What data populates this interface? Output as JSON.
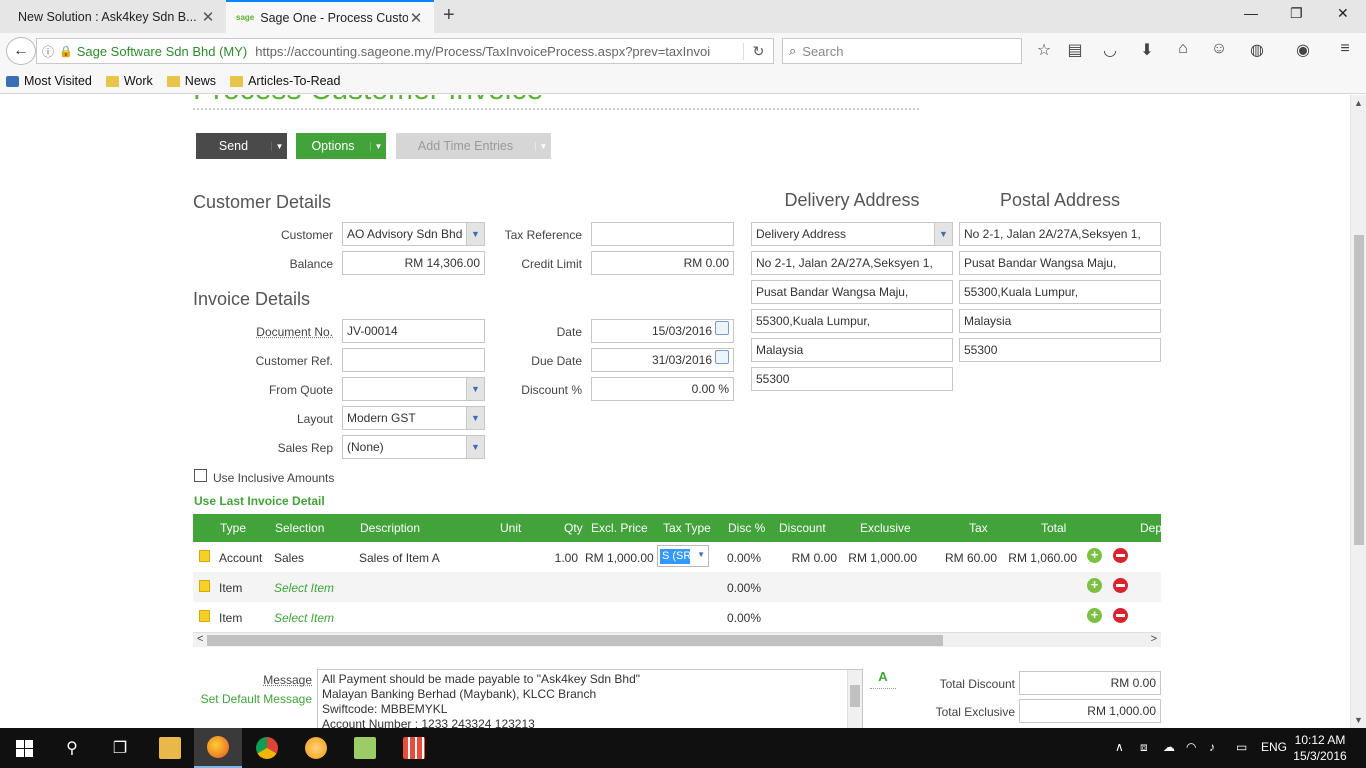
{
  "browser": {
    "tabs": [
      {
        "title": "New Solution : Ask4key Sdn B..."
      },
      {
        "title": "Sage One - Process Custo...",
        "favicon": "sage"
      }
    ],
    "url": {
      "site_identity": "Sage Software Sdn Bhd (MY)",
      "address": "https://accounting.sageone.my/Process/TaxInvoiceProcess.aspx?prev=taxInvoi"
    },
    "search_placeholder": "Search",
    "bookmarks": [
      "Most Visited",
      "Work",
      "News",
      "Articles-To-Read"
    ]
  },
  "page": {
    "title": "Process Customer Invoice",
    "toolbar": {
      "send": "Send",
      "options": "Options",
      "add_time_entries": "Add Time Entries"
    },
    "customer_details": {
      "heading": "Customer Details",
      "customer_label": "Customer",
      "customer_value": "AO Advisory Sdn Bhd",
      "balance_label": "Balance",
      "balance_value": "RM 14,306.00",
      "tax_ref_label": "Tax Reference",
      "tax_ref_value": "",
      "credit_limit_label": "Credit Limit",
      "credit_limit_value": "RM 0.00"
    },
    "invoice_details": {
      "heading": "Invoice Details",
      "doc_no_label": "Document No.",
      "doc_no_value": "JV-00014",
      "cust_ref_label": "Customer Ref.",
      "cust_ref_value": "",
      "from_quote_label": "From Quote",
      "from_quote_value": "",
      "layout_label": "Layout",
      "layout_value": "Modern GST",
      "sales_rep_label": "Sales Rep",
      "sales_rep_value": "(None)",
      "date_label": "Date",
      "date_value": "15/03/2016",
      "due_date_label": "Due Date",
      "due_date_value": "31/03/2016",
      "discount_label": "Discount %",
      "discount_value": "0.00 %"
    },
    "delivery_address": {
      "heading": "Delivery Address",
      "selector": "Delivery Address",
      "lines": [
        "No 2-1, Jalan 2A/27A,Seksyen 1,",
        "Pusat Bandar Wangsa Maju,",
        "55300,Kuala Lumpur,",
        "Malaysia",
        "55300"
      ]
    },
    "postal_address": {
      "heading": "Postal Address",
      "lines": [
        "No 2-1, Jalan 2A/27A,Seksyen 1,",
        "Pusat Bandar Wangsa Maju,",
        "55300,Kuala Lumpur,",
        "Malaysia",
        "55300"
      ]
    },
    "use_inclusive_amounts": "Use Inclusive Amounts",
    "use_last_invoice_detail": "Use Last Invoice Detail",
    "grid": {
      "headers": [
        "Type",
        "Selection",
        "Description",
        "Unit",
        "Qty",
        "Excl. Price",
        "Tax Type",
        "Disc %",
        "Discount",
        "Exclusive",
        "Tax",
        "Total",
        "Dep"
      ],
      "rows": [
        {
          "type": "Account",
          "selection": "Sales",
          "description": "Sales of Item A",
          "unit": "",
          "qty": "1.00",
          "excl_price": "RM 1,000.00",
          "tax_type": "S (SR",
          "disc": "0.00%",
          "discount": "RM 0.00",
          "exclusive": "RM 1,000.00",
          "tax": "RM 60.00",
          "total": "RM 1,060.00"
        },
        {
          "type": "Item",
          "selection": "Select Item",
          "disc": "0.00%"
        },
        {
          "type": "Item",
          "selection": "Select Item",
          "disc": "0.00%"
        }
      ]
    },
    "message": {
      "label": "Message",
      "set_default": "Set Default Message",
      "lines": [
        "All Payment should be made payable to \"Ask4key Sdn Bhd\"",
        "Malayan Banking Berhad (Maybank), KLCC Branch",
        "Swiftcode: MBBEMYKL",
        "Account Number : 1233 243324 123213"
      ]
    },
    "totals": {
      "total_discount_label": "Total Discount",
      "total_discount_value": "RM 0.00",
      "total_exclusive_label": "Total Exclusive",
      "total_exclusive_value": "RM 1,000.00"
    }
  },
  "taskbar": {
    "language": "ENG",
    "time": "10:12 AM",
    "date": "15/3/2016"
  },
  "colors": {
    "accent": "#41a33a",
    "dark_button": "#4a4a4a"
  }
}
